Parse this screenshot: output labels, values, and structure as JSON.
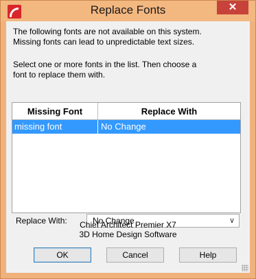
{
  "window": {
    "title": "Replace Fonts",
    "close_glyph": "✕",
    "icon": "chief-architect-app-icon"
  },
  "message": {
    "line1": "The following fonts are not available on this system.",
    "line2": "Missing fonts can lead to unpredictable text sizes.",
    "instruction1": "Select one or more fonts in the list.  Then choose a",
    "instruction2": "font to replace them with."
  },
  "list": {
    "headers": {
      "missing": "Missing Font",
      "replace": "Replace With"
    },
    "rows": [
      {
        "missing": "missing font",
        "replace": "No Change",
        "selected": true
      }
    ]
  },
  "replace_with": {
    "label": "Replace With:",
    "value": "No Change",
    "chevron": "∨"
  },
  "product": {
    "name": "Chief Architect Premier X7",
    "tagline": "3D Home Design Software"
  },
  "buttons": {
    "ok": "OK",
    "cancel": "Cancel",
    "help": "Help"
  },
  "colors": {
    "title_bar": "#f3b780",
    "close_button": "#c7423a",
    "selection": "#3399ff",
    "dialog_bg": "#f0f0f0"
  }
}
